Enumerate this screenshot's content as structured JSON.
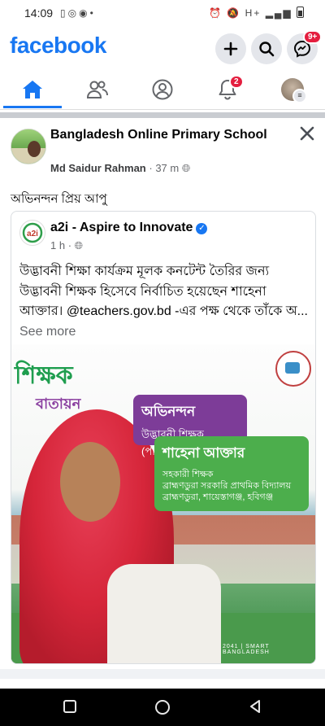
{
  "status_bar": {
    "time": "14:09",
    "network": "H+",
    "icons_left": [
      "sim-icon",
      "whatsapp-icon",
      "messenger-icon",
      "dot-icon"
    ],
    "icons_right": [
      "alarm-icon",
      "mute-icon",
      "signal-icon",
      "battery-icon"
    ]
  },
  "header": {
    "brand": "facebook",
    "messenger_badge": "9+"
  },
  "tabs": [
    {
      "name": "home",
      "active": true
    },
    {
      "name": "friends"
    },
    {
      "name": "profile"
    },
    {
      "name": "notifications",
      "badge": "2"
    },
    {
      "name": "menu"
    }
  ],
  "post": {
    "page_name": "Bangladesh Online Primary School",
    "author": "Md Saidur Rahman",
    "time": "37 m",
    "text": "অভিনন্দন প্রিয় আপু",
    "shared": {
      "name": "a2i - Aspire to Innovate",
      "logo_text": "a2i",
      "time": "1 h",
      "body": "উদ্ভাবনী শিক্ষা কার্যক্রম মূলক কনটেন্ট তৈরির জন্য উদ্ভাবনী শিক্ষক হিসেবে নির্বাচিত হয়েছেন শাহেনা আক্তার। @teachers.gov.bd -এর পক্ষ থেকে তাঁকে অ...",
      "see_more": "See more",
      "image": {
        "brand_top": "শিক্ষক",
        "brand_bottom": "বাতায়ন",
        "congrats": "অভিনন্দন",
        "category": "উদ্ভাবনী শিক্ষক (পাক্ষিক)",
        "teacher_name": "শাহেনা আক্তার",
        "designation": "সহকারী শিক্ষক",
        "school": "ব্রাহ্মণডুরা সরকারি প্রাথমিক বিদ্যালয়",
        "location": "ব্রাহ্মণডুরা, শায়েস্তাগঞ্জ, হবিগঞ্জ",
        "tagline": "2041 | SMART BANGLADESH"
      }
    }
  },
  "colors": {
    "brand": "#1877f2",
    "badge": "#e41e3f",
    "purple": "#7d3c98",
    "green": "#4cae4c"
  }
}
